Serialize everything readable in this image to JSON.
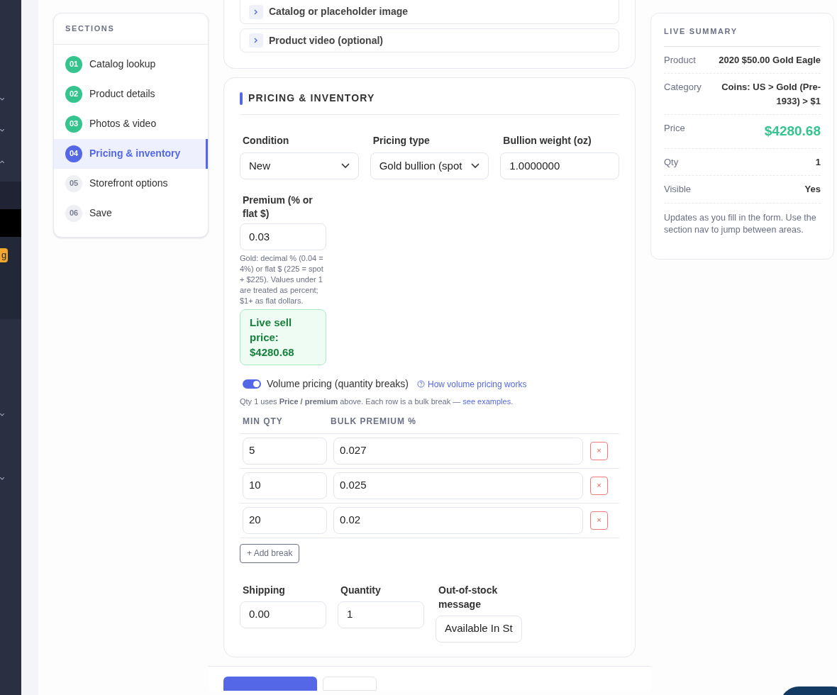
{
  "sidebar": {
    "badge": "g"
  },
  "sections": {
    "title": "SECTIONS",
    "items": [
      {
        "number": "01",
        "label": "Catalog lookup",
        "done": true,
        "selected": false
      },
      {
        "number": "02",
        "label": "Product details",
        "done": true,
        "selected": false
      },
      {
        "number": "03",
        "label": "Photos & video",
        "done": true,
        "selected": false
      },
      {
        "number": "04",
        "label": "Pricing & inventory",
        "done": false,
        "selected": true
      },
      {
        "number": "05",
        "label": "Storefront options",
        "done": false,
        "selected": false
      },
      {
        "number": "06",
        "label": "Save",
        "done": false,
        "selected": false
      }
    ]
  },
  "media_panels": [
    {
      "label": "Catalog or placeholder image",
      "expanded": false
    },
    {
      "label": "Product video (optional)",
      "expanded": false
    }
  ],
  "pricing": {
    "title": "PRICING & INVENTORY",
    "fields": [
      {
        "kind": "select",
        "label": "Condition",
        "value": "New"
      },
      {
        "kind": "select",
        "label": "Pricing type",
        "value": "Gold bullion (spot"
      },
      {
        "kind": "input",
        "label": "Bullion weight (oz)",
        "value": "1.0000000"
      }
    ],
    "premium": {
      "label": "Premium (% or flat $)",
      "value": "0.03",
      "help": "Gold: decimal % (0.04 = 4%) or flat $ (225 = spot + $225). Values under 1 are treated as percent; $1+ as flat dollars."
    },
    "live_price": "Live sell price: $4280.68",
    "volume": {
      "label": "Volume pricing (quantity breaks)",
      "on": true,
      "help_link": "How volume pricing works",
      "note": "Qty 1 uses **Price / premium** above. Each row is a bulk break —",
      "note_link": "see examples."
    },
    "columns": [
      "MIN QTY",
      "BULK PREMIUM %"
    ],
    "breaks": [
      {
        "min_qty": "5",
        "premium": "0.027",
        "remove": "×"
      },
      {
        "min_qty": "10",
        "premium": "0.025",
        "remove": "×"
      },
      {
        "min_qty": "20",
        "premium": "0.02",
        "remove": "×"
      }
    ],
    "add_break": "+ Add break",
    "bottom_fields": [
      {
        "label": "Shipping",
        "value": "0.00"
      },
      {
        "label": "Quantity",
        "value": "1"
      },
      {
        "label": "Out-of-stock message",
        "value": "Available In St"
      }
    ]
  },
  "summary": {
    "title": "LIVE SUMMARY",
    "rows": [
      {
        "kind": "text",
        "label": "Product",
        "value": "2020 $50.00 Gold Eagle"
      },
      {
        "kind": "text",
        "label": "Category",
        "value": "Coins: US > Gold (Pre-1933) > $1"
      },
      {
        "kind": "price",
        "label": "Price",
        "value": "$4280.68"
      },
      {
        "kind": "text",
        "label": "Qty",
        "value": "1"
      },
      {
        "kind": "text",
        "label": "Visible",
        "value": "Yes"
      }
    ],
    "note": "Updates as you fill in the form. Use the section nav to jump between areas."
  }
}
